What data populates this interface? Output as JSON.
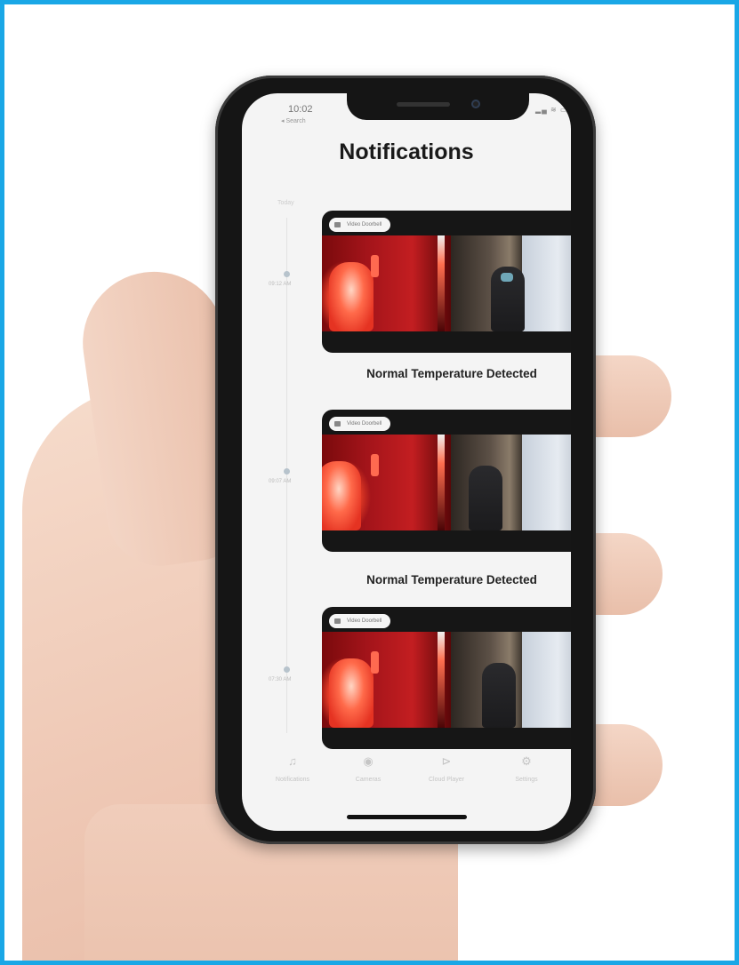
{
  "status_bar": {
    "time": "10:02",
    "back_label": "◂ Search",
    "icons": "▂▄ ≋ ▭"
  },
  "header": {
    "title": "Notifications"
  },
  "timeline": {
    "date_label": "Today"
  },
  "notifications": [
    {
      "badge": "Video Doorbell",
      "time": "09:12 AM",
      "title": "Normal Temperature Detected"
    },
    {
      "badge": "Video Doorbell",
      "time": "09:07 AM",
      "title": "Normal Temperature Detected"
    },
    {
      "badge": "Video Doorbell",
      "time": "07:30 AM",
      "title": ""
    }
  ],
  "tabbar": {
    "items": [
      {
        "label": "Notifications",
        "icon": "bell-icon"
      },
      {
        "label": "Cameras",
        "icon": "eye-icon"
      },
      {
        "label": "Cloud Player",
        "icon": "play-icon"
      },
      {
        "label": "Settings",
        "icon": "gear-icon"
      }
    ]
  },
  "colors": {
    "frame_border": "#1aa7e6",
    "screen_bg": "#f4f4f4",
    "card_bg": "#161616"
  }
}
